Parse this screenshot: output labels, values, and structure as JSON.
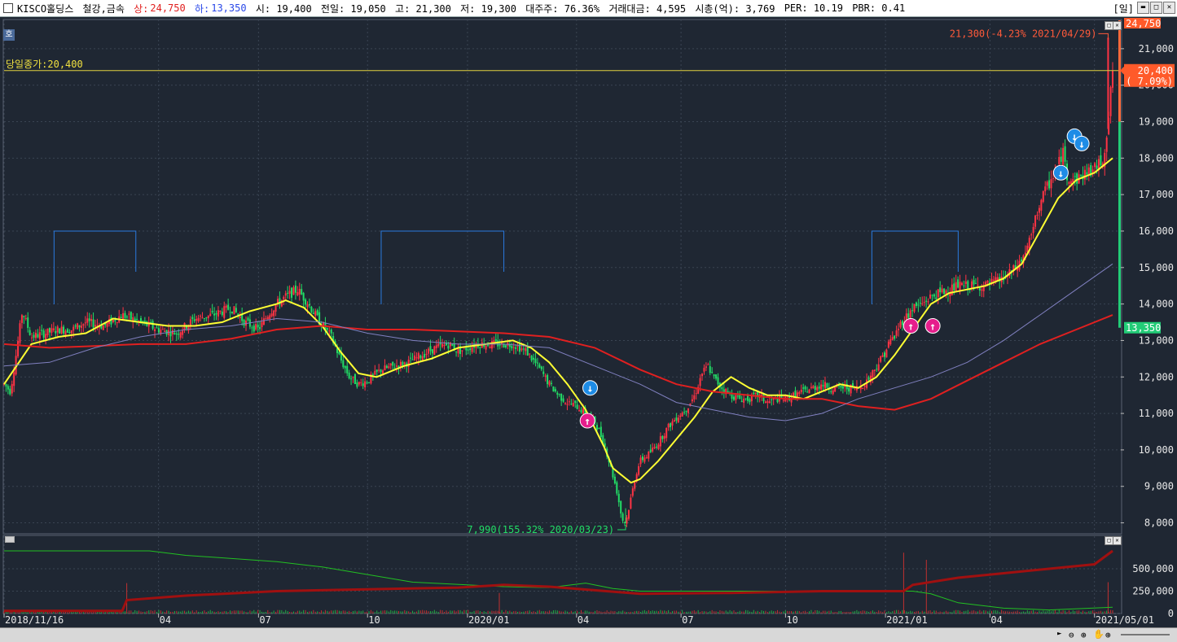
{
  "header": {
    "stock_name": "KISCO홀딩스",
    "sector": "철강,금속",
    "upper_label": "상:",
    "upper_value": "24,750",
    "lower_label": "하:",
    "lower_value": "13,350",
    "open": "시: 19,400",
    "prev_close": "전일: 19,050",
    "high": "고: 21,300",
    "low": "저: 19,300",
    "major_holder": "대주주: 76.36%",
    "trade_value": "거래대금: 4,595",
    "market_cap": "시총(억): 3,769",
    "per": "PER: 10.19",
    "pbr": "PBR: 0.41",
    "period": "[일]"
  },
  "side_button": "호",
  "chart_data": [
    {
      "type": "candlestick",
      "x_ticks": [
        "2018/11/16",
        "04",
        "07",
        "10",
        "2020/01",
        "04",
        "07",
        "10",
        "2021/01",
        "04",
        "2021/05/01"
      ],
      "y_ticks": [
        "21,000",
        "20,000",
        "19,000",
        "18,000",
        "17,000",
        "16,000",
        "15,000",
        "14,000",
        "13,000",
        "12,000",
        "11,000",
        "10,000",
        "9,000",
        "8,000"
      ],
      "ylim": [
        7700,
        21800
      ],
      "today_close_label": "당일종가:20,400",
      "today_close": 20400,
      "upper_limit": 24750,
      "lower_limit": 13350,
      "current_price": "20,400",
      "current_change": "( 7.09%)",
      "upper_tag": "24,750",
      "lower_tag": "13,350",
      "high_annotation": "21,300(-4.23% 2021/04/29)",
      "low_annotation": "7,990(155.32% 2020/03/23)",
      "price_path": [
        [
          0,
          11800
        ],
        [
          0.007,
          11600
        ],
        [
          0.012,
          12400
        ],
        [
          0.02,
          13800
        ],
        [
          0.03,
          13100
        ],
        [
          0.045,
          13200
        ],
        [
          0.06,
          13300
        ],
        [
          0.075,
          13300
        ],
        [
          0.09,
          13500
        ],
        [
          0.11,
          13400
        ],
        [
          0.13,
          13700
        ],
        [
          0.15,
          13500
        ],
        [
          0.17,
          13300
        ],
        [
          0.19,
          13200
        ],
        [
          0.21,
          13600
        ],
        [
          0.23,
          13700
        ],
        [
          0.25,
          13900
        ],
        [
          0.265,
          13500
        ],
        [
          0.28,
          13300
        ],
        [
          0.29,
          13700
        ],
        [
          0.3,
          14000
        ],
        [
          0.31,
          14200
        ],
        [
          0.323,
          14400
        ],
        [
          0.335,
          14000
        ],
        [
          0.345,
          13600
        ],
        [
          0.36,
          13100
        ],
        [
          0.37,
          12500
        ],
        [
          0.38,
          12000
        ],
        [
          0.39,
          11800
        ],
        [
          0.4,
          11900
        ],
        [
          0.415,
          12200
        ],
        [
          0.43,
          12300
        ],
        [
          0.445,
          12400
        ],
        [
          0.46,
          12600
        ],
        [
          0.475,
          12800
        ],
        [
          0.49,
          12900
        ],
        [
          0.5,
          12700
        ],
        [
          0.52,
          12900
        ],
        [
          0.54,
          12900
        ],
        [
          0.56,
          12900
        ],
        [
          0.575,
          12700
        ],
        [
          0.59,
          12200
        ],
        [
          0.6,
          11800
        ],
        [
          0.61,
          11500
        ],
        [
          0.62,
          11300
        ],
        [
          0.63,
          11200
        ],
        [
          0.64,
          11000
        ],
        [
          0.65,
          10800
        ],
        [
          0.66,
          10200
        ],
        [
          0.668,
          9500
        ],
        [
          0.675,
          8800
        ],
        [
          0.68,
          8100
        ],
        [
          0.684,
          7990
        ],
        [
          0.69,
          8700
        ],
        [
          0.695,
          9300
        ],
        [
          0.7,
          9700
        ],
        [
          0.71,
          9900
        ],
        [
          0.72,
          10200
        ],
        [
          0.73,
          10600
        ],
        [
          0.74,
          10900
        ],
        [
          0.75,
          11100
        ],
        [
          0.76,
          11500
        ],
        [
          0.768,
          12100
        ],
        [
          0.775,
          12300
        ],
        [
          0.78,
          12000
        ],
        [
          0.79,
          11700
        ],
        [
          0.8,
          11500
        ],
        [
          0.81,
          11400
        ],
        [
          0.82,
          11400
        ],
        [
          0.83,
          11500
        ],
        [
          0.84,
          11300
        ],
        [
          0.85,
          11400
        ],
        [
          0.86,
          11400
        ],
        [
          0.87,
          11500
        ],
        [
          0.88,
          11600
        ],
        [
          0.89,
          11700
        ],
        [
          0.9,
          11800
        ],
        [
          0.91,
          11700
        ],
        [
          0.92,
          11700
        ],
        [
          0.93,
          11700
        ],
        [
          0.94,
          11700
        ],
        [
          0.95,
          11900
        ],
        [
          0.96,
          12300
        ],
        [
          0.97,
          12700
        ],
        [
          0.975,
          13000
        ],
        [
          0.98,
          13100
        ],
        [
          0.985,
          13400
        ],
        [
          0.99,
          13600
        ],
        [
          0.995,
          13700
        ],
        [
          1.0,
          13900
        ],
        [
          1.01,
          14000
        ],
        [
          1.02,
          14200
        ],
        [
          1.03,
          14300
        ],
        [
          1.04,
          14400
        ],
        [
          1.05,
          14500
        ],
        [
          1.06,
          14500
        ],
        [
          1.07,
          14500
        ],
        [
          1.08,
          14500
        ],
        [
          1.09,
          14600
        ],
        [
          1.1,
          14700
        ],
        [
          1.11,
          14900
        ],
        [
          1.12,
          15200
        ],
        [
          1.13,
          15800
        ],
        [
          1.14,
          16800
        ],
        [
          1.15,
          17300
        ],
        [
          1.16,
          17800
        ],
        [
          1.165,
          18200
        ],
        [
          1.17,
          17500
        ],
        [
          1.18,
          17400
        ],
        [
          1.19,
          17600
        ],
        [
          1.2,
          17700
        ],
        [
          1.21,
          18000
        ],
        [
          1.215,
          19000
        ],
        [
          1.22,
          20400
        ]
      ],
      "series": [
        {
          "name": "",
          "color": "#ffff33",
          "values": [
            [
              0,
              11800
            ],
            [
              0.03,
              12900
            ],
            [
              0.06,
              13100
            ],
            [
              0.09,
              13200
            ],
            [
              0.12,
              13600
            ],
            [
              0.15,
              13500
            ],
            [
              0.18,
              13400
            ],
            [
              0.21,
              13400
            ],
            [
              0.24,
              13500
            ],
            [
              0.27,
              13800
            ],
            [
              0.3,
              14000
            ],
            [
              0.31,
              14100
            ],
            [
              0.33,
              13900
            ],
            [
              0.35,
              13400
            ],
            [
              0.37,
              12700
            ],
            [
              0.39,
              12100
            ],
            [
              0.41,
              12000
            ],
            [
              0.44,
              12300
            ],
            [
              0.47,
              12500
            ],
            [
              0.5,
              12800
            ],
            [
              0.53,
              12900
            ],
            [
              0.56,
              13000
            ],
            [
              0.58,
              12800
            ],
            [
              0.6,
              12400
            ],
            [
              0.62,
              11800
            ],
            [
              0.64,
              11100
            ],
            [
              0.66,
              10100
            ],
            [
              0.67,
              9500
            ],
            [
              0.69,
              9100
            ],
            [
              0.7,
              9200
            ],
            [
              0.72,
              9700
            ],
            [
              0.74,
              10300
            ],
            [
              0.76,
              10900
            ],
            [
              0.78,
              11600
            ],
            [
              0.8,
              12000
            ],
            [
              0.82,
              11700
            ],
            [
              0.84,
              11500
            ],
            [
              0.86,
              11500
            ],
            [
              0.88,
              11400
            ],
            [
              0.9,
              11600
            ],
            [
              0.92,
              11800
            ],
            [
              0.94,
              11700
            ],
            [
              0.96,
              12000
            ],
            [
              0.98,
              12600
            ],
            [
              1.0,
              13300
            ],
            [
              1.02,
              14000
            ],
            [
              1.04,
              14300
            ],
            [
              1.06,
              14400
            ],
            [
              1.08,
              14500
            ],
            [
              1.1,
              14700
            ],
            [
              1.12,
              15100
            ],
            [
              1.14,
              16000
            ],
            [
              1.16,
              16900
            ],
            [
              1.18,
              17400
            ],
            [
              1.2,
              17600
            ],
            [
              1.22,
              18000
            ]
          ]
        },
        {
          "name": "",
          "color": "#e02020",
          "values": [
            [
              0,
              12900
            ],
            [
              0.05,
              12800
            ],
            [
              0.1,
              12850
            ],
            [
              0.15,
              12900
            ],
            [
              0.2,
              12900
            ],
            [
              0.25,
              13050
            ],
            [
              0.3,
              13300
            ],
            [
              0.35,
              13400
            ],
            [
              0.4,
              13300
            ],
            [
              0.45,
              13300
            ],
            [
              0.5,
              13250
            ],
            [
              0.55,
              13200
            ],
            [
              0.6,
              13100
            ],
            [
              0.65,
              12800
            ],
            [
              0.7,
              12200
            ],
            [
              0.74,
              11800
            ],
            [
              0.78,
              11600
            ],
            [
              0.82,
              11500
            ],
            [
              0.86,
              11400
            ],
            [
              0.9,
              11400
            ],
            [
              0.94,
              11200
            ],
            [
              0.98,
              11100
            ],
            [
              1.02,
              11400
            ],
            [
              1.06,
              11900
            ],
            [
              1.1,
              12400
            ],
            [
              1.14,
              12900
            ],
            [
              1.18,
              13300
            ],
            [
              1.22,
              13700
            ]
          ]
        },
        {
          "name": "",
          "color": "#8080c0",
          "values": [
            [
              0,
              12300
            ],
            [
              0.05,
              12400
            ],
            [
              0.1,
              12800
            ],
            [
              0.15,
              13100
            ],
            [
              0.2,
              13300
            ],
            [
              0.25,
              13400
            ],
            [
              0.3,
              13600
            ],
            [
              0.35,
              13500
            ],
            [
              0.4,
              13200
            ],
            [
              0.45,
              13000
            ],
            [
              0.5,
              12900
            ],
            [
              0.55,
              12900
            ],
            [
              0.6,
              12800
            ],
            [
              0.65,
              12300
            ],
            [
              0.7,
              11800
            ],
            [
              0.74,
              11300
            ],
            [
              0.78,
              11100
            ],
            [
              0.82,
              10900
            ],
            [
              0.86,
              10800
            ],
            [
              0.9,
              11000
            ],
            [
              0.94,
              11400
            ],
            [
              0.98,
              11700
            ],
            [
              1.02,
              12000
            ],
            [
              1.06,
              12400
            ],
            [
              1.1,
              13000
            ],
            [
              1.14,
              13700
            ],
            [
              1.18,
              14400
            ],
            [
              1.22,
              15100
            ]
          ]
        }
      ],
      "signals": [
        {
          "type": "sell",
          "x": 0.645,
          "price": 11700
        },
        {
          "type": "buy",
          "x": 0.642,
          "price": 10800
        },
        {
          "type": "buy",
          "x": 0.998,
          "price": 13400
        },
        {
          "type": "buy",
          "x": 1.022,
          "price": 13400
        },
        {
          "type": "sell",
          "x": 1.163,
          "price": 17600
        },
        {
          "type": "sell",
          "x": 1.178,
          "price": 18600
        },
        {
          "type": "sell",
          "x": 1.186,
          "price": 18400
        }
      ],
      "swing_markers": [
        {
          "x1": 0.055,
          "x2": 0.145,
          "price": 16000
        },
        {
          "x1": 0.415,
          "x2": 0.55,
          "price": 16000
        },
        {
          "x1": 0.955,
          "x2": 1.05,
          "price": 16000
        }
      ]
    },
    {
      "type": "bar+line",
      "y_ticks": [
        "500,000",
        "250,000",
        "0"
      ],
      "ylim": [
        0,
        800000
      ],
      "volume_spikes": [
        [
          0.135,
          340000
        ],
        [
          0.545,
          230000
        ],
        [
          0.99,
          680000
        ],
        [
          1.015,
          600000
        ],
        [
          1.215,
          350000
        ]
      ],
      "series": [
        {
          "name": "",
          "color": "#22c022",
          "values": [
            [
              0,
              700000
            ],
            [
              0.16,
              700000
            ],
            [
              0.2,
              650000
            ],
            [
              0.3,
              580000
            ],
            [
              0.35,
              520000
            ],
            [
              0.45,
              350000
            ],
            [
              0.55,
              300000
            ],
            [
              0.6,
              290000
            ],
            [
              0.64,
              340000
            ],
            [
              0.67,
              280000
            ],
            [
              0.7,
              250000
            ],
            [
              0.8,
              250000
            ],
            [
              0.9,
              250000
            ],
            [
              1.0,
              250000
            ],
            [
              1.02,
              220000
            ],
            [
              1.05,
              120000
            ],
            [
              1.1,
              60000
            ],
            [
              1.15,
              40000
            ],
            [
              1.22,
              70000
            ]
          ]
        },
        {
          "name": "",
          "color": "#a01010",
          "values": [
            [
              0,
              30000
            ],
            [
              0.13,
              30000
            ],
            [
              0.135,
              150000
            ],
            [
              0.2,
              200000
            ],
            [
              0.3,
              250000
            ],
            [
              0.4,
              270000
            ],
            [
              0.5,
              290000
            ],
            [
              0.55,
              320000
            ],
            [
              0.6,
              300000
            ],
            [
              0.65,
              260000
            ],
            [
              0.7,
              220000
            ],
            [
              0.8,
              230000
            ],
            [
              0.9,
              250000
            ],
            [
              0.99,
              250000
            ],
            [
              1.0,
              320000
            ],
            [
              1.05,
              400000
            ],
            [
              1.1,
              450000
            ],
            [
              1.15,
              500000
            ],
            [
              1.2,
              550000
            ],
            [
              1.22,
              700000
            ]
          ]
        }
      ]
    }
  ]
}
